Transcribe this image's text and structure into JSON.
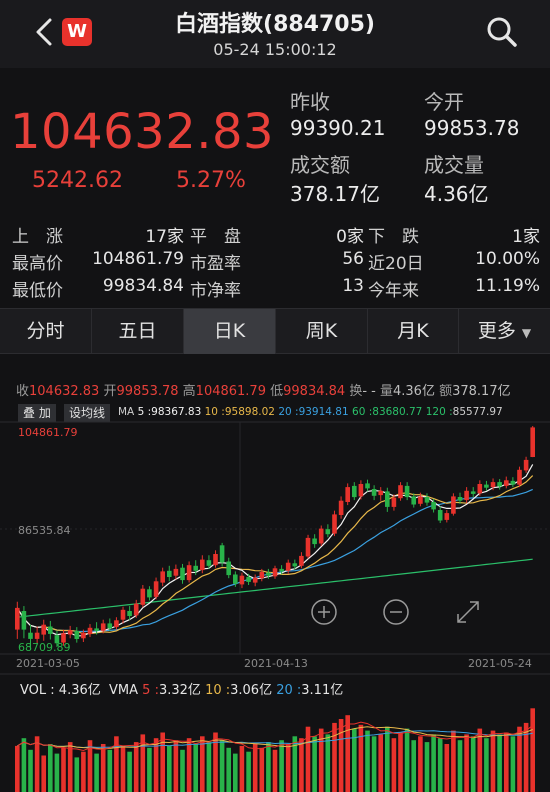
{
  "header": {
    "title": "白酒指数(884705)",
    "datetime": "05-24 15:00:12",
    "logo_letter": "W",
    "back_icon": "chevron-left-icon",
    "search_icon": "search-icon"
  },
  "quote": {
    "price": "104632.83",
    "change": "5242.62",
    "change_pct": "5.27%",
    "prev_close_label": "昨收",
    "prev_close": "99390.21",
    "open_label": "今开",
    "open": "99853.78",
    "turnover_label": "成交额",
    "turnover": "378.17亿",
    "volume_label": "成交量",
    "volume": "4.36亿"
  },
  "stats": {
    "rise_label": "上　涨",
    "rise": "17家",
    "flat_label": "平　盘",
    "flat": "0家",
    "fall_label": "下　跌",
    "fall": "1家",
    "high_label": "最高价",
    "high": "104861.79",
    "pe_label": "市盈率",
    "pe": "56",
    "d20_label": "近20日",
    "d20": "10.00%",
    "low_label": "最低价",
    "low": "99834.84",
    "pb_label": "市净率",
    "pb": "13",
    "ytd_label": "今年来",
    "ytd": "11.19%"
  },
  "tabs": [
    "分时",
    "五日",
    "日K",
    "周K",
    "月K",
    "更多"
  ],
  "active_tab": "日K",
  "kline": {
    "ohlc": {
      "close_k": "收",
      "close": "104632.83",
      "open_k": "开",
      "open": "99853.78",
      "high_k": "高",
      "high": "104861.79",
      "low_k": "低",
      "low": "99834.84",
      "chg_k": "换",
      "chg": "- -",
      "vol_k": "量",
      "vol": "4.36亿",
      "amt_k": "额",
      "amt": "378.17亿"
    },
    "buttons": {
      "overlay": "叠 加",
      "set_ma": "设均线"
    },
    "ma": {
      "label": "MA",
      "ma5_k": "5 :",
      "ma5": "98367.83",
      "ma10_k": "10 :",
      "ma10": "95898.02",
      "ma20_k": "20 :",
      "ma20": "93914.81",
      "ma60_k": "60 :",
      "ma60": "83680.77",
      "ma120_k": "120 :",
      "ma120": "85577.97"
    },
    "price_max_label": "104861.79",
    "price_mid_label": "86535.84",
    "price_min_label": "68709.89",
    "dates": [
      "2021-03-05",
      "2021-04-13",
      "2021-05-24"
    ],
    "colors": {
      "up": "#e8322c",
      "down": "#29b34a",
      "ma5": "#f2f2f2",
      "ma10": "#e8b84a",
      "ma20": "#3aa0e0",
      "ma60": "#2bc06a"
    },
    "vol_panel": {
      "vol_k": "VOL :",
      "vol": "4.36亿",
      "vma_k": "VMA",
      "vma5_k": "5 :",
      "vma5": "3.32亿",
      "vma10_k": "10 :",
      "vma10": "3.06亿",
      "vma20_k": "20 :",
      "vma20": "3.11亿"
    }
  },
  "chart_data": {
    "type": "candlestick",
    "title": "白酒指数(884705)",
    "y_range": [
      68709.89,
      104861.79
    ],
    "x_labels": [
      "2021-03-05",
      "2021-04-13",
      "2021-05-24"
    ],
    "candles": [
      {
        "o": 72000,
        "c": 75500,
        "h": 76500,
        "l": 70500
      },
      {
        "o": 75000,
        "c": 72000,
        "h": 75800,
        "l": 70600
      },
      {
        "o": 71500,
        "c": 70500,
        "h": 72800,
        "l": 68709.89
      },
      {
        "o": 70500,
        "c": 71500,
        "h": 72500,
        "l": 69800
      },
      {
        "o": 71200,
        "c": 72800,
        "h": 73600,
        "l": 70200
      },
      {
        "o": 72500,
        "c": 71300,
        "h": 73400,
        "l": 70400
      },
      {
        "o": 71100,
        "c": 69800,
        "h": 71800,
        "l": 69200
      },
      {
        "o": 69900,
        "c": 71400,
        "h": 72000,
        "l": 69400
      },
      {
        "o": 71200,
        "c": 71900,
        "h": 72600,
        "l": 70600
      },
      {
        "o": 71800,
        "c": 70500,
        "h": 72400,
        "l": 69900
      },
      {
        "o": 70600,
        "c": 71500,
        "h": 72000,
        "l": 70000
      },
      {
        "o": 71300,
        "c": 72300,
        "h": 72900,
        "l": 70800
      },
      {
        "o": 72200,
        "c": 71800,
        "h": 73200,
        "l": 71200
      },
      {
        "o": 71800,
        "c": 73000,
        "h": 73600,
        "l": 71400
      },
      {
        "o": 73000,
        "c": 72200,
        "h": 73800,
        "l": 71800
      },
      {
        "o": 72400,
        "c": 73500,
        "h": 74000,
        "l": 72000
      },
      {
        "o": 73600,
        "c": 75200,
        "h": 75700,
        "l": 73000
      },
      {
        "o": 75000,
        "c": 74200,
        "h": 75800,
        "l": 73500
      },
      {
        "o": 74300,
        "c": 76200,
        "h": 76800,
        "l": 73900
      },
      {
        "o": 76000,
        "c": 78600,
        "h": 79200,
        "l": 75600
      },
      {
        "o": 78500,
        "c": 77200,
        "h": 79000,
        "l": 76700
      },
      {
        "o": 77300,
        "c": 79800,
        "h": 80400,
        "l": 76900
      },
      {
        "o": 79600,
        "c": 81400,
        "h": 82000,
        "l": 79000
      },
      {
        "o": 81500,
        "c": 80500,
        "h": 82300,
        "l": 79800
      },
      {
        "o": 80700,
        "c": 81800,
        "h": 82500,
        "l": 80100
      },
      {
        "o": 82000,
        "c": 80000,
        "h": 82600,
        "l": 79400
      },
      {
        "o": 80000,
        "c": 82400,
        "h": 83000,
        "l": 79600
      },
      {
        "o": 82300,
        "c": 81500,
        "h": 83200,
        "l": 80800
      },
      {
        "o": 81600,
        "c": 83300,
        "h": 84000,
        "l": 81100
      },
      {
        "o": 83200,
        "c": 82300,
        "h": 84000,
        "l": 81800
      },
      {
        "o": 82400,
        "c": 84200,
        "h": 84800,
        "l": 82000
      },
      {
        "o": 85600,
        "c": 82800,
        "h": 86000,
        "l": 82200
      },
      {
        "o": 83000,
        "c": 80800,
        "h": 83600,
        "l": 80300
      },
      {
        "o": 80900,
        "c": 79400,
        "h": 81400,
        "l": 78900
      },
      {
        "o": 79300,
        "c": 80700,
        "h": 81200,
        "l": 78700
      },
      {
        "o": 80500,
        "c": 79700,
        "h": 81000,
        "l": 79200
      },
      {
        "o": 79600,
        "c": 80400,
        "h": 80900,
        "l": 79000
      },
      {
        "o": 80300,
        "c": 81300,
        "h": 81800,
        "l": 79800
      },
      {
        "o": 81200,
        "c": 80700,
        "h": 81800,
        "l": 80200
      },
      {
        "o": 80600,
        "c": 81900,
        "h": 82300,
        "l": 80200
      },
      {
        "o": 81800,
        "c": 81400,
        "h": 82400,
        "l": 80900
      },
      {
        "o": 81500,
        "c": 82800,
        "h": 83300,
        "l": 81000
      },
      {
        "o": 82700,
        "c": 82200,
        "h": 83300,
        "l": 81700
      },
      {
        "o": 82300,
        "c": 83900,
        "h": 84500,
        "l": 81900
      },
      {
        "o": 83800,
        "c": 86800,
        "h": 87300,
        "l": 83500
      },
      {
        "o": 86700,
        "c": 85800,
        "h": 87400,
        "l": 85200
      },
      {
        "o": 85900,
        "c": 88300,
        "h": 88800,
        "l": 85500
      },
      {
        "o": 88200,
        "c": 87400,
        "h": 89000,
        "l": 86900
      },
      {
        "o": 87500,
        "c": 90600,
        "h": 91200,
        "l": 87100
      },
      {
        "o": 90500,
        "c": 92800,
        "h": 93500,
        "l": 89900
      },
      {
        "o": 92600,
        "c": 95000,
        "h": 95600,
        "l": 92100
      },
      {
        "o": 95200,
        "c": 93400,
        "h": 95800,
        "l": 92900
      },
      {
        "o": 93500,
        "c": 95500,
        "h": 96100,
        "l": 93000
      },
      {
        "o": 95600,
        "c": 94800,
        "h": 96200,
        "l": 94300
      },
      {
        "o": 94700,
        "c": 93600,
        "h": 95300,
        "l": 92900
      },
      {
        "o": 93700,
        "c": 94400,
        "h": 95000,
        "l": 92800
      },
      {
        "o": 94300,
        "c": 91800,
        "h": 94900,
        "l": 91000
      },
      {
        "o": 91800,
        "c": 93300,
        "h": 93800,
        "l": 91200
      },
      {
        "o": 93200,
        "c": 95300,
        "h": 95800,
        "l": 92800
      },
      {
        "o": 95200,
        "c": 93400,
        "h": 95800,
        "l": 92900
      },
      {
        "o": 93500,
        "c": 92200,
        "h": 94000,
        "l": 91700
      },
      {
        "o": 92300,
        "c": 93500,
        "h": 94100,
        "l": 91900
      },
      {
        "o": 93400,
        "c": 92500,
        "h": 94000,
        "l": 92000
      },
      {
        "o": 92600,
        "c": 91400,
        "h": 93100,
        "l": 90900
      },
      {
        "o": 91300,
        "c": 89600,
        "h": 91900,
        "l": 89200
      },
      {
        "o": 89700,
        "c": 90800,
        "h": 91300,
        "l": 89300
      },
      {
        "o": 90700,
        "c": 93500,
        "h": 94000,
        "l": 90400
      },
      {
        "o": 93400,
        "c": 92800,
        "h": 94100,
        "l": 92300
      },
      {
        "o": 92900,
        "c": 94400,
        "h": 95000,
        "l": 92400
      },
      {
        "o": 94300,
        "c": 93900,
        "h": 95000,
        "l": 93400
      },
      {
        "o": 94000,
        "c": 95500,
        "h": 96100,
        "l": 93600
      },
      {
        "o": 95400,
        "c": 94900,
        "h": 96000,
        "l": 94400
      },
      {
        "o": 95000,
        "c": 95800,
        "h": 96400,
        "l": 94500
      },
      {
        "o": 95800,
        "c": 95100,
        "h": 96300,
        "l": 94600
      },
      {
        "o": 95200,
        "c": 96100,
        "h": 96700,
        "l": 94800
      },
      {
        "o": 96000,
        "c": 95400,
        "h": 96600,
        "l": 95000
      },
      {
        "o": 95400,
        "c": 97800,
        "h": 98300,
        "l": 95000
      },
      {
        "o": 97700,
        "c": 99390.21,
        "h": 99900,
        "l": 97300
      },
      {
        "o": 99853.78,
        "c": 104632.83,
        "h": 104861.79,
        "l": 99834.84
      }
    ],
    "volume_scale_max": 5,
    "volume": [
      2.4,
      2.8,
      2.2,
      2.9,
      1.9,
      2.5,
      2.0,
      2.3,
      2.6,
      1.8,
      2.1,
      2.7,
      2.0,
      2.5,
      2.2,
      2.9,
      2.4,
      2.1,
      2.6,
      3.0,
      2.3,
      2.8,
      3.1,
      2.4,
      2.7,
      2.2,
      2.8,
      2.5,
      2.9,
      2.6,
      3.1,
      2.7,
      2.3,
      2.0,
      2.4,
      2.1,
      2.5,
      2.3,
      2.6,
      2.2,
      2.7,
      2.5,
      2.9,
      2.8,
      3.4,
      2.9,
      3.3,
      3.0,
      3.6,
      3.8,
      4.0,
      3.3,
      3.5,
      3.2,
      2.9,
      3.0,
      3.4,
      2.8,
      3.1,
      3.3,
      2.7,
      2.9,
      2.6,
      3.0,
      2.8,
      2.5,
      3.2,
      2.7,
      3.0,
      2.9,
      3.3,
      2.8,
      3.2,
      3.0,
      3.1,
      2.9,
      3.4,
      3.6,
      4.36
    ]
  }
}
